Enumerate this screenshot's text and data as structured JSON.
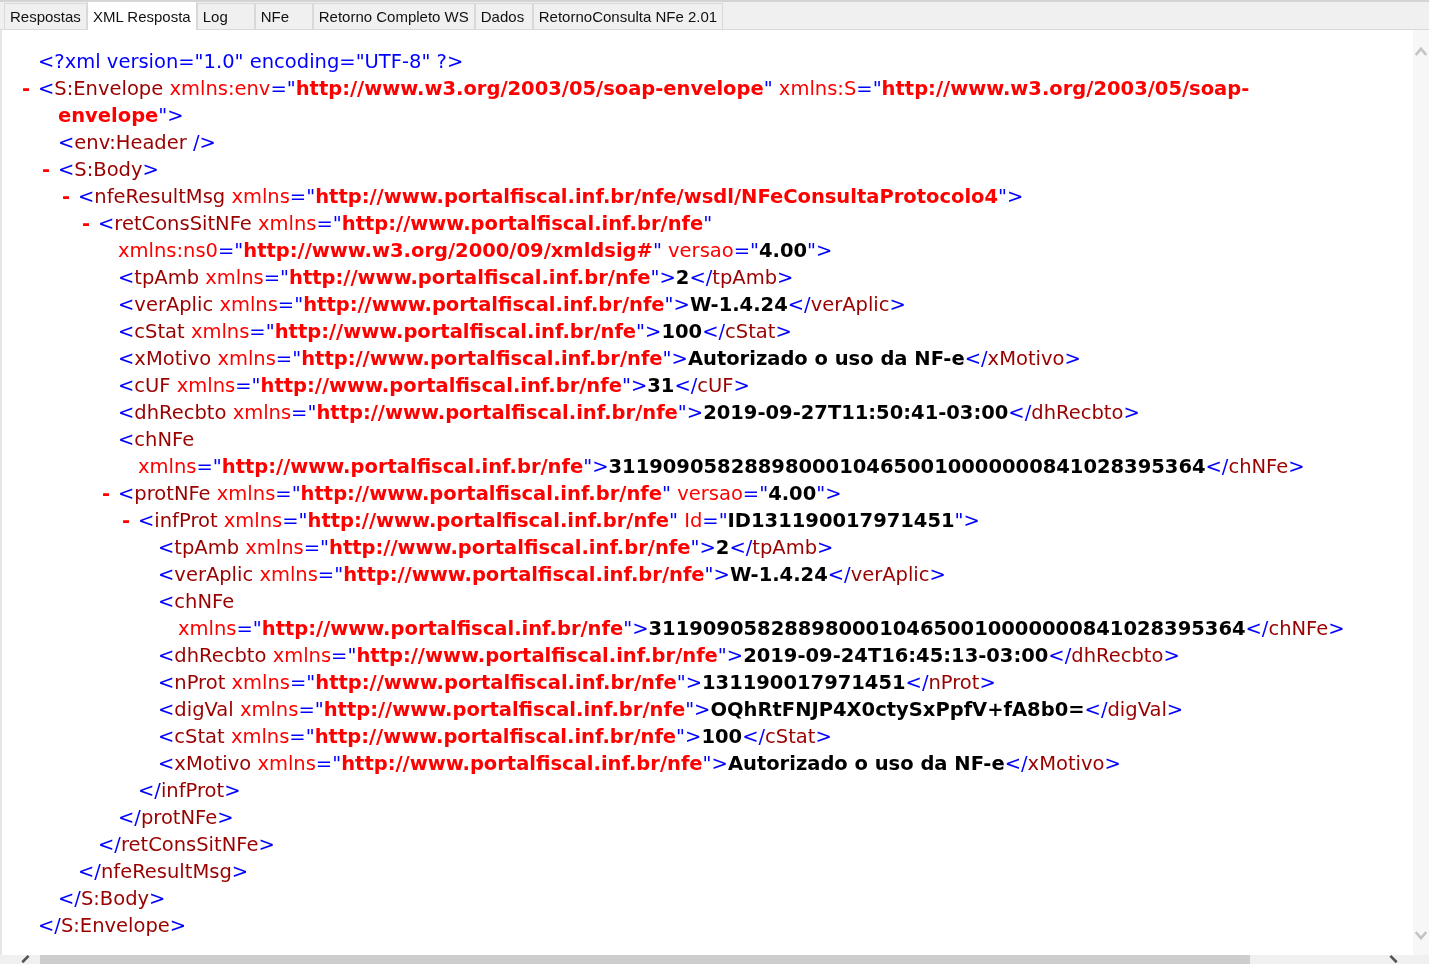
{
  "tabs": [
    {
      "label": "Respostas",
      "selected": false
    },
    {
      "label": "XML Resposta",
      "selected": true
    },
    {
      "label": "Log",
      "selected": false
    },
    {
      "label": "NFe",
      "selected": false
    },
    {
      "label": "Retorno Completo WS",
      "selected": false
    },
    {
      "label": "Dados",
      "selected": false
    },
    {
      "label": "RetornoConsulta NFe 2.01",
      "selected": false
    }
  ],
  "xml": [
    {
      "lines": [
        [
          {
            "kind": "punct",
            "text": "<?xml version=\"1.0\" encoding=\"UTF-8\" ?>"
          }
        ]
      ]
    },
    {
      "toggle": "-",
      "expanded": true,
      "lines": [
        [
          {
            "kind": "punct",
            "text": "<"
          },
          {
            "kind": "tag",
            "text": "S:Envelope"
          },
          {
            "kind": "attr",
            "text": " xmlns:env"
          },
          {
            "kind": "punct",
            "text": "=\""
          },
          {
            "kind": "value",
            "text": "http://www.w3.org/2003/05/soap-envelope"
          },
          {
            "kind": "punct",
            "text": "\""
          },
          {
            "kind": "attr",
            "text": " xmlns:S"
          },
          {
            "kind": "punct",
            "text": "=\""
          },
          {
            "kind": "value",
            "text": "http://www.w3.org/2003/05/soap-"
          }
        ],
        [
          {
            "kind": "value",
            "text": "envelope"
          },
          {
            "kind": "punct",
            "text": "\">"
          }
        ]
      ],
      "children": [
        {
          "lines": [
            [
              {
                "kind": "punct",
                "text": "<"
              },
              {
                "kind": "tag",
                "text": "env:Header"
              },
              {
                "kind": "punct",
                "text": " />"
              }
            ]
          ]
        },
        {
          "toggle": "-",
          "expanded": true,
          "lines": [
            [
              {
                "kind": "punct",
                "text": "<"
              },
              {
                "kind": "tag",
                "text": "S:Body"
              },
              {
                "kind": "punct",
                "text": ">"
              }
            ]
          ],
          "children": [
            {
              "toggle": "-",
              "expanded": true,
              "lines": [
                [
                  {
                    "kind": "punct",
                    "text": "<"
                  },
                  {
                    "kind": "tag",
                    "text": "nfeResultMsg"
                  },
                  {
                    "kind": "attr",
                    "text": " xmlns"
                  },
                  {
                    "kind": "punct",
                    "text": "=\""
                  },
                  {
                    "kind": "value",
                    "text": "http://www.portalfiscal.inf.br/nfe/wsdl/NFeConsultaProtocolo4"
                  },
                  {
                    "kind": "punct",
                    "text": "\">"
                  }
                ]
              ],
              "children": [
                {
                  "toggle": "-",
                  "expanded": true,
                  "lines": [
                    [
                      {
                        "kind": "punct",
                        "text": "<"
                      },
                      {
                        "kind": "tag",
                        "text": "retConsSitNFe"
                      },
                      {
                        "kind": "attr",
                        "text": " xmlns"
                      },
                      {
                        "kind": "punct",
                        "text": "=\""
                      },
                      {
                        "kind": "value",
                        "text": "http://www.portalfiscal.inf.br/nfe"
                      },
                      {
                        "kind": "punct",
                        "text": "\""
                      }
                    ],
                    [
                      {
                        "kind": "attr",
                        "text": "xmlns:ns0"
                      },
                      {
                        "kind": "punct",
                        "text": "=\""
                      },
                      {
                        "kind": "value",
                        "text": "http://www.w3.org/2000/09/xmldsig#"
                      },
                      {
                        "kind": "punct",
                        "text": "\""
                      },
                      {
                        "kind": "attr",
                        "text": " versao"
                      },
                      {
                        "kind": "punct",
                        "text": "=\""
                      },
                      {
                        "kind": "content",
                        "text": "4.00"
                      },
                      {
                        "kind": "punct",
                        "text": "\">"
                      }
                    ]
                  ],
                  "children": [
                    {
                      "lines": [
                        [
                          {
                            "kind": "punct",
                            "text": "<"
                          },
                          {
                            "kind": "tag",
                            "text": "tpAmb"
                          },
                          {
                            "kind": "attr",
                            "text": " xmlns"
                          },
                          {
                            "kind": "punct",
                            "text": "=\""
                          },
                          {
                            "kind": "value",
                            "text": "http://www.portalfiscal.inf.br/nfe"
                          },
                          {
                            "kind": "punct",
                            "text": "\">"
                          },
                          {
                            "kind": "content",
                            "text": "2"
                          },
                          {
                            "kind": "punct",
                            "text": "</"
                          },
                          {
                            "kind": "tag",
                            "text": "tpAmb"
                          },
                          {
                            "kind": "punct",
                            "text": ">"
                          }
                        ]
                      ]
                    },
                    {
                      "lines": [
                        [
                          {
                            "kind": "punct",
                            "text": "<"
                          },
                          {
                            "kind": "tag",
                            "text": "verAplic"
                          },
                          {
                            "kind": "attr",
                            "text": " xmlns"
                          },
                          {
                            "kind": "punct",
                            "text": "=\""
                          },
                          {
                            "kind": "value",
                            "text": "http://www.portalfiscal.inf.br/nfe"
                          },
                          {
                            "kind": "punct",
                            "text": "\">"
                          },
                          {
                            "kind": "content",
                            "text": "W-1.4.24"
                          },
                          {
                            "kind": "punct",
                            "text": "</"
                          },
                          {
                            "kind": "tag",
                            "text": "verAplic"
                          },
                          {
                            "kind": "punct",
                            "text": ">"
                          }
                        ]
                      ]
                    },
                    {
                      "lines": [
                        [
                          {
                            "kind": "punct",
                            "text": "<"
                          },
                          {
                            "kind": "tag",
                            "text": "cStat"
                          },
                          {
                            "kind": "attr",
                            "text": " xmlns"
                          },
                          {
                            "kind": "punct",
                            "text": "=\""
                          },
                          {
                            "kind": "value",
                            "text": "http://www.portalfiscal.inf.br/nfe"
                          },
                          {
                            "kind": "punct",
                            "text": "\">"
                          },
                          {
                            "kind": "content",
                            "text": "100"
                          },
                          {
                            "kind": "punct",
                            "text": "</"
                          },
                          {
                            "kind": "tag",
                            "text": "cStat"
                          },
                          {
                            "kind": "punct",
                            "text": ">"
                          }
                        ]
                      ]
                    },
                    {
                      "lines": [
                        [
                          {
                            "kind": "punct",
                            "text": "<"
                          },
                          {
                            "kind": "tag",
                            "text": "xMotivo"
                          },
                          {
                            "kind": "attr",
                            "text": " xmlns"
                          },
                          {
                            "kind": "punct",
                            "text": "=\""
                          },
                          {
                            "kind": "value",
                            "text": "http://www.portalfiscal.inf.br/nfe"
                          },
                          {
                            "kind": "punct",
                            "text": "\">"
                          },
                          {
                            "kind": "content",
                            "text": "Autorizado o uso da NF-e"
                          },
                          {
                            "kind": "punct",
                            "text": "</"
                          },
                          {
                            "kind": "tag",
                            "text": "xMotivo"
                          },
                          {
                            "kind": "punct",
                            "text": ">"
                          }
                        ]
                      ]
                    },
                    {
                      "lines": [
                        [
                          {
                            "kind": "punct",
                            "text": "<"
                          },
                          {
                            "kind": "tag",
                            "text": "cUF"
                          },
                          {
                            "kind": "attr",
                            "text": " xmlns"
                          },
                          {
                            "kind": "punct",
                            "text": "=\""
                          },
                          {
                            "kind": "value",
                            "text": "http://www.portalfiscal.inf.br/nfe"
                          },
                          {
                            "kind": "punct",
                            "text": "\">"
                          },
                          {
                            "kind": "content",
                            "text": "31"
                          },
                          {
                            "kind": "punct",
                            "text": "</"
                          },
                          {
                            "kind": "tag",
                            "text": "cUF"
                          },
                          {
                            "kind": "punct",
                            "text": ">"
                          }
                        ]
                      ]
                    },
                    {
                      "lines": [
                        [
                          {
                            "kind": "punct",
                            "text": "<"
                          },
                          {
                            "kind": "tag",
                            "text": "dhRecbto"
                          },
                          {
                            "kind": "attr",
                            "text": " xmlns"
                          },
                          {
                            "kind": "punct",
                            "text": "=\""
                          },
                          {
                            "kind": "value",
                            "text": "http://www.portalfiscal.inf.br/nfe"
                          },
                          {
                            "kind": "punct",
                            "text": "\">"
                          },
                          {
                            "kind": "content",
                            "text": "2019-09-27T11:50:41-03:00"
                          },
                          {
                            "kind": "punct",
                            "text": "</"
                          },
                          {
                            "kind": "tag",
                            "text": "dhRecbto"
                          },
                          {
                            "kind": "punct",
                            "text": ">"
                          }
                        ]
                      ]
                    },
                    {
                      "lines": [
                        [
                          {
                            "kind": "punct",
                            "text": "<"
                          },
                          {
                            "kind": "tag",
                            "text": "chNFe"
                          }
                        ],
                        [
                          {
                            "kind": "attr",
                            "text": "xmlns"
                          },
                          {
                            "kind": "punct",
                            "text": "=\""
                          },
                          {
                            "kind": "value",
                            "text": "http://www.portalfiscal.inf.br/nfe"
                          },
                          {
                            "kind": "punct",
                            "text": "\">"
                          },
                          {
                            "kind": "content",
                            "text": "31190905828898000104650010000000841028395364"
                          },
                          {
                            "kind": "punct",
                            "text": "</"
                          },
                          {
                            "kind": "tag",
                            "text": "chNFe"
                          },
                          {
                            "kind": "punct",
                            "text": ">"
                          }
                        ]
                      ]
                    },
                    {
                      "toggle": "-",
                      "expanded": true,
                      "lines": [
                        [
                          {
                            "kind": "punct",
                            "text": "<"
                          },
                          {
                            "kind": "tag",
                            "text": "protNFe"
                          },
                          {
                            "kind": "attr",
                            "text": " xmlns"
                          },
                          {
                            "kind": "punct",
                            "text": "=\""
                          },
                          {
                            "kind": "value",
                            "text": "http://www.portalfiscal.inf.br/nfe"
                          },
                          {
                            "kind": "punct",
                            "text": "\""
                          },
                          {
                            "kind": "attr",
                            "text": " versao"
                          },
                          {
                            "kind": "punct",
                            "text": "=\""
                          },
                          {
                            "kind": "content",
                            "text": "4.00"
                          },
                          {
                            "kind": "punct",
                            "text": "\">"
                          }
                        ]
                      ],
                      "children": [
                        {
                          "toggle": "-",
                          "expanded": true,
                          "lines": [
                            [
                              {
                                "kind": "punct",
                                "text": "<"
                              },
                              {
                                "kind": "tag",
                                "text": "infProt"
                              },
                              {
                                "kind": "attr",
                                "text": " xmlns"
                              },
                              {
                                "kind": "punct",
                                "text": "=\""
                              },
                              {
                                "kind": "value",
                                "text": "http://www.portalfiscal.inf.br/nfe"
                              },
                              {
                                "kind": "punct",
                                "text": "\""
                              },
                              {
                                "kind": "attr",
                                "text": " Id"
                              },
                              {
                                "kind": "punct",
                                "text": "=\""
                              },
                              {
                                "kind": "content",
                                "text": "ID131190017971451"
                              },
                              {
                                "kind": "punct",
                                "text": "\">"
                              }
                            ]
                          ],
                          "children": [
                            {
                              "lines": [
                                [
                                  {
                                    "kind": "punct",
                                    "text": "<"
                                  },
                                  {
                                    "kind": "tag",
                                    "text": "tpAmb"
                                  },
                                  {
                                    "kind": "attr",
                                    "text": " xmlns"
                                  },
                                  {
                                    "kind": "punct",
                                    "text": "=\""
                                  },
                                  {
                                    "kind": "value",
                                    "text": "http://www.portalfiscal.inf.br/nfe"
                                  },
                                  {
                                    "kind": "punct",
                                    "text": "\">"
                                  },
                                  {
                                    "kind": "content",
                                    "text": "2"
                                  },
                                  {
                                    "kind": "punct",
                                    "text": "</"
                                  },
                                  {
                                    "kind": "tag",
                                    "text": "tpAmb"
                                  },
                                  {
                                    "kind": "punct",
                                    "text": ">"
                                  }
                                ]
                              ]
                            },
                            {
                              "lines": [
                                [
                                  {
                                    "kind": "punct",
                                    "text": "<"
                                  },
                                  {
                                    "kind": "tag",
                                    "text": "verAplic"
                                  },
                                  {
                                    "kind": "attr",
                                    "text": " xmlns"
                                  },
                                  {
                                    "kind": "punct",
                                    "text": "=\""
                                  },
                                  {
                                    "kind": "value",
                                    "text": "http://www.portalfiscal.inf.br/nfe"
                                  },
                                  {
                                    "kind": "punct",
                                    "text": "\">"
                                  },
                                  {
                                    "kind": "content",
                                    "text": "W-1.4.24"
                                  },
                                  {
                                    "kind": "punct",
                                    "text": "</"
                                  },
                                  {
                                    "kind": "tag",
                                    "text": "verAplic"
                                  },
                                  {
                                    "kind": "punct",
                                    "text": ">"
                                  }
                                ]
                              ]
                            },
                            {
                              "lines": [
                                [
                                  {
                                    "kind": "punct",
                                    "text": "<"
                                  },
                                  {
                                    "kind": "tag",
                                    "text": "chNFe"
                                  }
                                ],
                                [
                                  {
                                    "kind": "attr",
                                    "text": "xmlns"
                                  },
                                  {
                                    "kind": "punct",
                                    "text": "=\""
                                  },
                                  {
                                    "kind": "value",
                                    "text": "http://www.portalfiscal.inf.br/nfe"
                                  },
                                  {
                                    "kind": "punct",
                                    "text": "\">"
                                  },
                                  {
                                    "kind": "content",
                                    "text": "31190905828898000104650010000000841028395364"
                                  },
                                  {
                                    "kind": "punct",
                                    "text": "</"
                                  },
                                  {
                                    "kind": "tag",
                                    "text": "chNFe"
                                  },
                                  {
                                    "kind": "punct",
                                    "text": ">"
                                  }
                                ]
                              ]
                            },
                            {
                              "lines": [
                                [
                                  {
                                    "kind": "punct",
                                    "text": "<"
                                  },
                                  {
                                    "kind": "tag",
                                    "text": "dhRecbto"
                                  },
                                  {
                                    "kind": "attr",
                                    "text": " xmlns"
                                  },
                                  {
                                    "kind": "punct",
                                    "text": "=\""
                                  },
                                  {
                                    "kind": "value",
                                    "text": "http://www.portalfiscal.inf.br/nfe"
                                  },
                                  {
                                    "kind": "punct",
                                    "text": "\">"
                                  },
                                  {
                                    "kind": "content",
                                    "text": "2019-09-24T16:45:13-03:00"
                                  },
                                  {
                                    "kind": "punct",
                                    "text": "</"
                                  },
                                  {
                                    "kind": "tag",
                                    "text": "dhRecbto"
                                  },
                                  {
                                    "kind": "punct",
                                    "text": ">"
                                  }
                                ]
                              ]
                            },
                            {
                              "lines": [
                                [
                                  {
                                    "kind": "punct",
                                    "text": "<"
                                  },
                                  {
                                    "kind": "tag",
                                    "text": "nProt"
                                  },
                                  {
                                    "kind": "attr",
                                    "text": " xmlns"
                                  },
                                  {
                                    "kind": "punct",
                                    "text": "=\""
                                  },
                                  {
                                    "kind": "value",
                                    "text": "http://www.portalfiscal.inf.br/nfe"
                                  },
                                  {
                                    "kind": "punct",
                                    "text": "\">"
                                  },
                                  {
                                    "kind": "content",
                                    "text": "131190017971451"
                                  },
                                  {
                                    "kind": "punct",
                                    "text": "</"
                                  },
                                  {
                                    "kind": "tag",
                                    "text": "nProt"
                                  },
                                  {
                                    "kind": "punct",
                                    "text": ">"
                                  }
                                ]
                              ]
                            },
                            {
                              "lines": [
                                [
                                  {
                                    "kind": "punct",
                                    "text": "<"
                                  },
                                  {
                                    "kind": "tag",
                                    "text": "digVal"
                                  },
                                  {
                                    "kind": "attr",
                                    "text": " xmlns"
                                  },
                                  {
                                    "kind": "punct",
                                    "text": "=\""
                                  },
                                  {
                                    "kind": "value",
                                    "text": "http://www.portalfiscal.inf.br/nfe"
                                  },
                                  {
                                    "kind": "punct",
                                    "text": "\">"
                                  },
                                  {
                                    "kind": "content",
                                    "text": "OQhRtFNJP4X0ctySxPpfV+fA8b0="
                                  },
                                  {
                                    "kind": "punct",
                                    "text": "</"
                                  },
                                  {
                                    "kind": "tag",
                                    "text": "digVal"
                                  },
                                  {
                                    "kind": "punct",
                                    "text": ">"
                                  }
                                ]
                              ]
                            },
                            {
                              "lines": [
                                [
                                  {
                                    "kind": "punct",
                                    "text": "<"
                                  },
                                  {
                                    "kind": "tag",
                                    "text": "cStat"
                                  },
                                  {
                                    "kind": "attr",
                                    "text": " xmlns"
                                  },
                                  {
                                    "kind": "punct",
                                    "text": "=\""
                                  },
                                  {
                                    "kind": "value",
                                    "text": "http://www.portalfiscal.inf.br/nfe"
                                  },
                                  {
                                    "kind": "punct",
                                    "text": "\">"
                                  },
                                  {
                                    "kind": "content",
                                    "text": "100"
                                  },
                                  {
                                    "kind": "punct",
                                    "text": "</"
                                  },
                                  {
                                    "kind": "tag",
                                    "text": "cStat"
                                  },
                                  {
                                    "kind": "punct",
                                    "text": ">"
                                  }
                                ]
                              ]
                            },
                            {
                              "lines": [
                                [
                                  {
                                    "kind": "punct",
                                    "text": "<"
                                  },
                                  {
                                    "kind": "tag",
                                    "text": "xMotivo"
                                  },
                                  {
                                    "kind": "attr",
                                    "text": " xmlns"
                                  },
                                  {
                                    "kind": "punct",
                                    "text": "=\""
                                  },
                                  {
                                    "kind": "value",
                                    "text": "http://www.portalfiscal.inf.br/nfe"
                                  },
                                  {
                                    "kind": "punct",
                                    "text": "\">"
                                  },
                                  {
                                    "kind": "content",
                                    "text": "Autorizado o uso da NF-e"
                                  },
                                  {
                                    "kind": "punct",
                                    "text": "</"
                                  },
                                  {
                                    "kind": "tag",
                                    "text": "xMotivo"
                                  },
                                  {
                                    "kind": "punct",
                                    "text": ">"
                                  }
                                ]
                              ]
                            }
                          ],
                          "close": [
                            {
                              "kind": "punct",
                              "text": "</"
                            },
                            {
                              "kind": "tag",
                              "text": "infProt"
                            },
                            {
                              "kind": "punct",
                              "text": ">"
                            }
                          ]
                        }
                      ],
                      "close": [
                        {
                          "kind": "punct",
                          "text": "</"
                        },
                        {
                          "kind": "tag",
                          "text": "protNFe"
                        },
                        {
                          "kind": "punct",
                          "text": ">"
                        }
                      ]
                    }
                  ],
                  "close": [
                    {
                      "kind": "punct",
                      "text": "</"
                    },
                    {
                      "kind": "tag",
                      "text": "retConsSitNFe"
                    },
                    {
                      "kind": "punct",
                      "text": ">"
                    }
                  ]
                }
              ],
              "close": [
                {
                  "kind": "punct",
                  "text": "</"
                },
                {
                  "kind": "tag",
                  "text": "nfeResultMsg"
                },
                {
                  "kind": "punct",
                  "text": ">"
                }
              ]
            }
          ],
          "close": [
            {
              "kind": "punct",
              "text": "</"
            },
            {
              "kind": "tag",
              "text": "S:Body"
            },
            {
              "kind": "punct",
              "text": ">"
            }
          ]
        }
      ],
      "close": [
        {
          "kind": "punct",
          "text": "</"
        },
        {
          "kind": "tag",
          "text": "S:Envelope"
        },
        {
          "kind": "punct",
          "text": ">"
        }
      ]
    }
  ]
}
